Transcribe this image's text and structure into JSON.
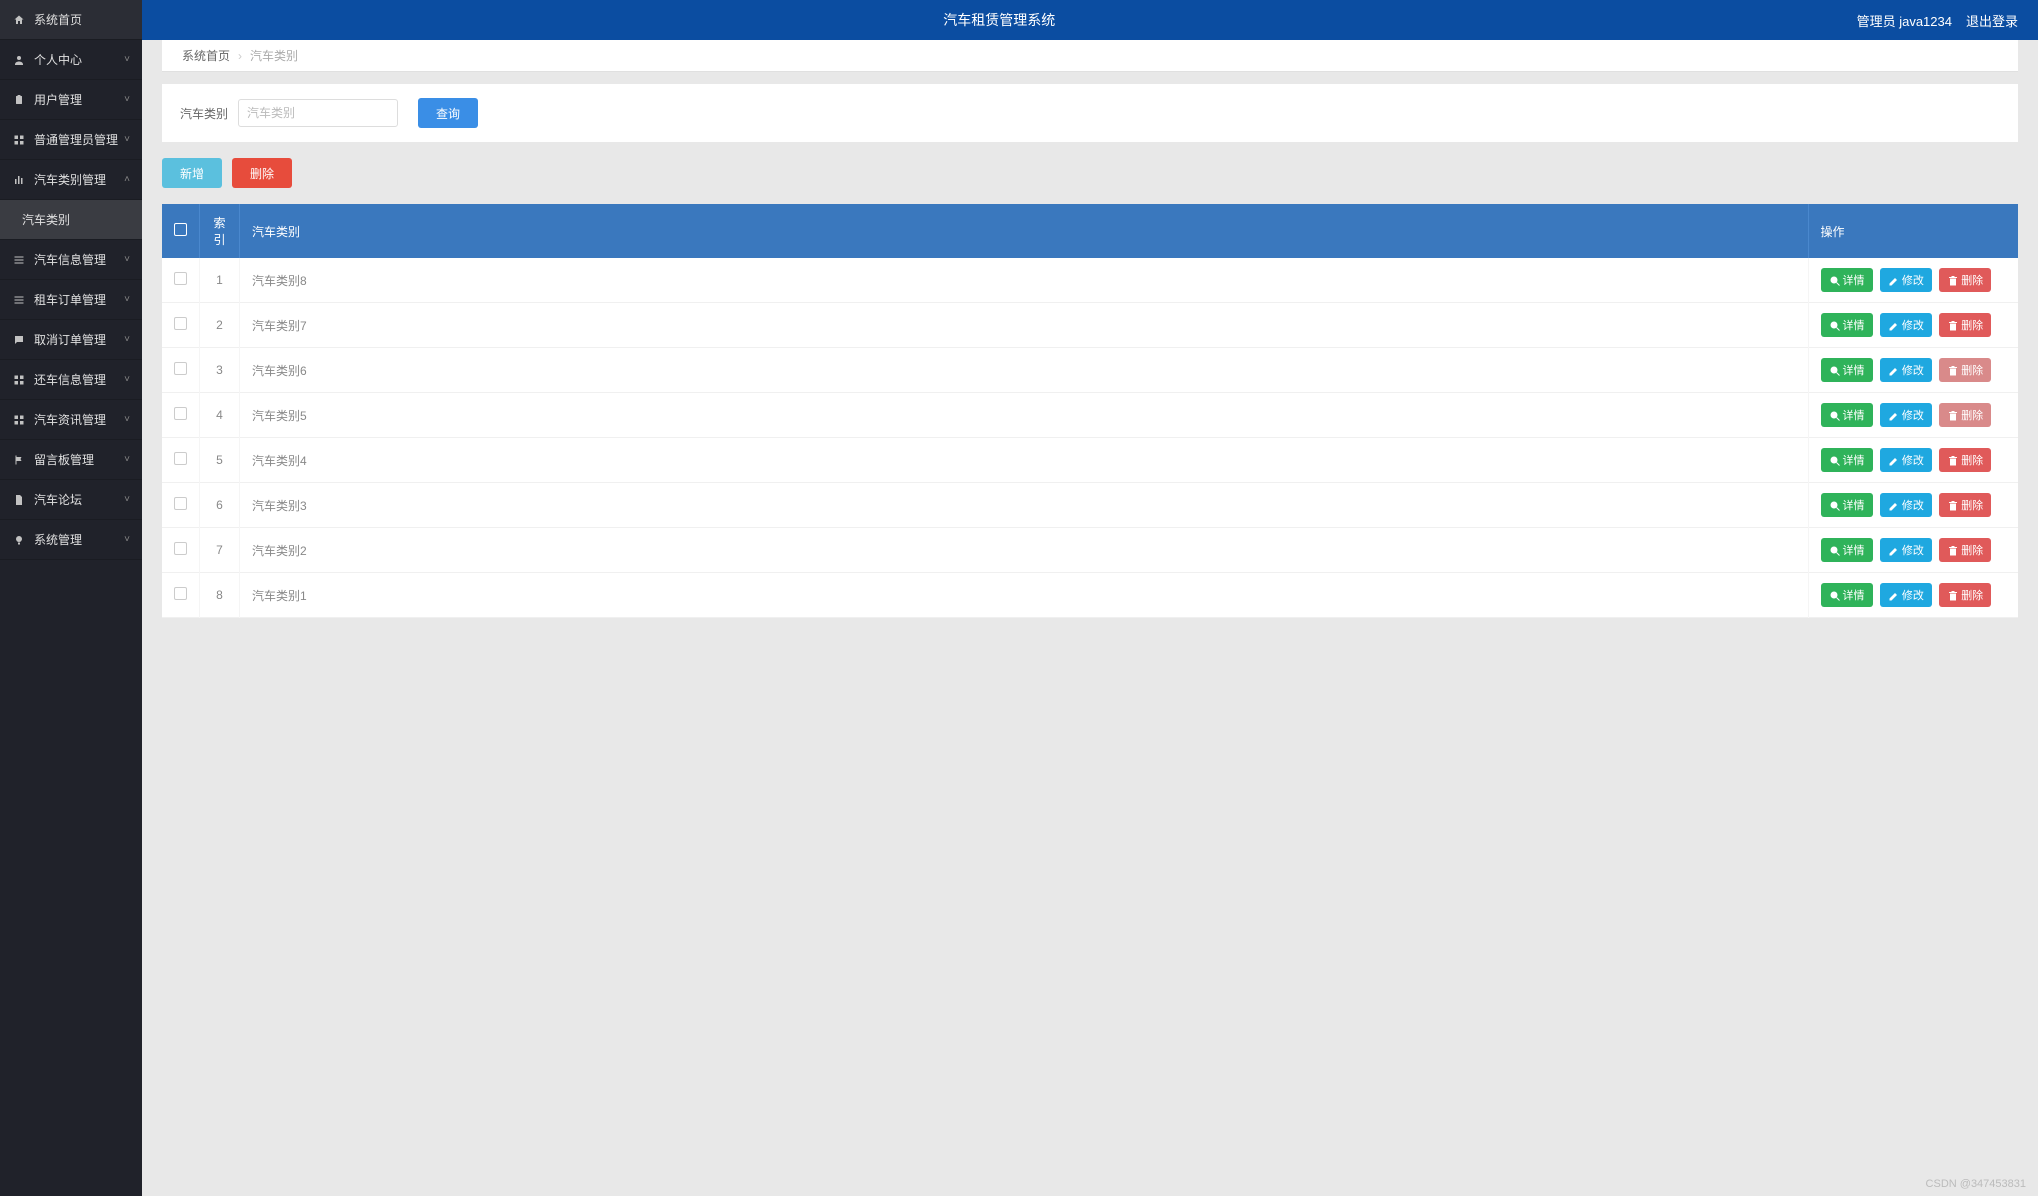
{
  "header": {
    "title": "汽车租赁管理系统",
    "role": "管理员 java1234",
    "logout": "退出登录"
  },
  "sidebar": {
    "items": [
      {
        "icon": "home-icon",
        "label": "系统首页",
        "caret": ""
      },
      {
        "icon": "user-icon",
        "label": "个人中心",
        "caret": "˅"
      },
      {
        "icon": "clipboard-icon",
        "label": "用户管理",
        "caret": "˅"
      },
      {
        "icon": "grid-icon",
        "label": "普通管理员管理",
        "caret": "˅"
      },
      {
        "icon": "bar-icon",
        "label": "汽车类别管理",
        "caret": "˄"
      },
      {
        "icon": "",
        "label": "汽车类别",
        "caret": ""
      },
      {
        "icon": "list-icon",
        "label": "汽车信息管理",
        "caret": "˅"
      },
      {
        "icon": "list2-icon",
        "label": "租车订单管理",
        "caret": "˅"
      },
      {
        "icon": "chat-icon",
        "label": "取消订单管理",
        "caret": "˅"
      },
      {
        "icon": "grid2-icon",
        "label": "还车信息管理",
        "caret": "˅"
      },
      {
        "icon": "grid2-icon",
        "label": "汽车资讯管理",
        "caret": "˅"
      },
      {
        "icon": "flag-icon",
        "label": "留言板管理",
        "caret": "˅"
      },
      {
        "icon": "doc-icon",
        "label": "汽车论坛",
        "caret": "˅"
      },
      {
        "icon": "bulb-icon",
        "label": "系统管理",
        "caret": "˅"
      }
    ],
    "active_sub_index": 5
  },
  "breadcrumb": {
    "home": "系统首页",
    "current": "汽车类别"
  },
  "search": {
    "label": "汽车类别",
    "placeholder": "汽车类别",
    "button": "查询"
  },
  "actions": {
    "add": "新增",
    "delete": "删除"
  },
  "table": {
    "headers": {
      "index": "索引",
      "category": "汽车类别",
      "action": "操作"
    },
    "action_labels": {
      "detail": "详情",
      "edit": "修改",
      "delete": "删除"
    },
    "rows": [
      {
        "index": "1",
        "category": "汽车类别8"
      },
      {
        "index": "2",
        "category": "汽车类别7"
      },
      {
        "index": "3",
        "category": "汽车类别6"
      },
      {
        "index": "4",
        "category": "汽车类别5"
      },
      {
        "index": "5",
        "category": "汽车类别4"
      },
      {
        "index": "6",
        "category": "汽车类别3"
      },
      {
        "index": "7",
        "category": "汽车类别2"
      },
      {
        "index": "8",
        "category": "汽车类别1"
      }
    ]
  },
  "watermark": "CSDN @347453831"
}
